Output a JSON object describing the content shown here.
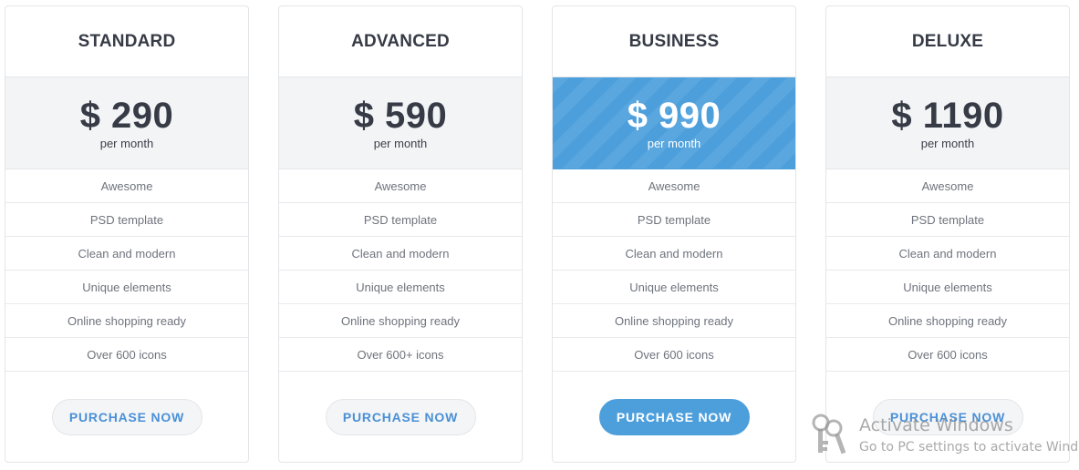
{
  "plans": [
    {
      "name": "STANDARD",
      "price": "$ 290",
      "period": "per month",
      "featured": false,
      "features": [
        "Awesome",
        "PSD template",
        "Clean and modern",
        "Unique elements",
        "Online shopping ready",
        "Over 600 icons"
      ],
      "button_label": "PURCHASE NOW"
    },
    {
      "name": "ADVANCED",
      "price": "$ 590",
      "period": "per month",
      "featured": false,
      "features": [
        "Awesome",
        "PSD template",
        "Clean and modern",
        "Unique elements",
        "Online shopping ready",
        "Over 600+ icons"
      ],
      "button_label": "PURCHASE NOW"
    },
    {
      "name": "BUSINESS",
      "price": "$ 990",
      "period": "per month",
      "featured": true,
      "features": [
        "Awesome",
        "PSD template",
        "Clean and modern",
        "Unique elements",
        "Online shopping ready",
        "Over 600 icons"
      ],
      "button_label": "PURCHASE NOW"
    },
    {
      "name": "DELUXE",
      "price": "$ 1190",
      "period": "per month",
      "featured": false,
      "features": [
        "Awesome",
        "PSD template",
        "Clean and modern",
        "Unique elements",
        "Online shopping ready",
        "Over 600 icons"
      ],
      "button_label": "PURCHASE NOW"
    }
  ],
  "colors": {
    "accent": "#4d9fdc",
    "link": "#4a90d6",
    "heading": "#363b46",
    "muted": "#6e737c",
    "price_bg": "#f3f4f6"
  },
  "watermark": {
    "icon": "keys-icon",
    "title": "Activate Windows",
    "subtitle": "Go to PC settings to activate Windows."
  }
}
